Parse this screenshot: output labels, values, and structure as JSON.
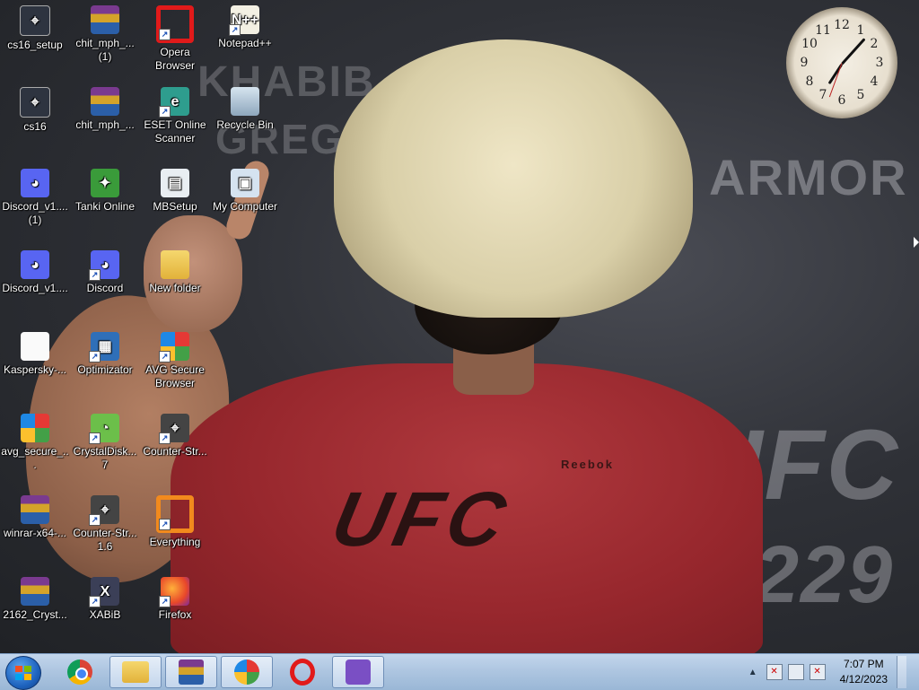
{
  "desktop": {
    "wallpaper_text": [
      "KHABIB",
      "GREGO",
      "ARMOR",
      "UFC",
      "229"
    ],
    "shirt_logo": "UFC",
    "shirt_brand": "Reebok",
    "icons": [
      {
        "label": "cs16_setup",
        "icon": "counter-strike-icon",
        "shortcut": false
      },
      {
        "label": "chit_mph_... (1)",
        "icon": "winrar-archive-icon",
        "shortcut": false
      },
      {
        "label": "Opera Browser",
        "icon": "opera-icon",
        "shortcut": true
      },
      {
        "label": "Notepad++",
        "icon": "notepad-plus-plus-icon",
        "shortcut": true
      },
      {
        "label": "cs16",
        "icon": "counter-strike-icon",
        "shortcut": false
      },
      {
        "label": "chit_mph_...",
        "icon": "winrar-archive-icon",
        "shortcut": false
      },
      {
        "label": "ESET Online Scanner",
        "icon": "eset-icon",
        "shortcut": true
      },
      {
        "label": "Recycle Bin",
        "icon": "recycle-bin-icon",
        "shortcut": false
      },
      {
        "label": "Discord_v1.... (1)",
        "icon": "discord-icon",
        "shortcut": false
      },
      {
        "label": "Tanki Online",
        "icon": "tanki-online-icon",
        "shortcut": false
      },
      {
        "label": "MBSetup",
        "icon": "installer-icon",
        "shortcut": false
      },
      {
        "label": "My Computer",
        "icon": "computer-icon",
        "shortcut": false
      },
      {
        "label": "Discord_v1....",
        "icon": "discord-icon",
        "shortcut": false
      },
      {
        "label": "Discord",
        "icon": "discord-icon",
        "shortcut": true
      },
      {
        "label": "New folder",
        "icon": "folder-icon",
        "shortcut": false
      },
      {
        "label": "Kaspersky-...",
        "icon": "file-icon",
        "shortcut": false
      },
      {
        "label": "Optimizator",
        "icon": "optimizator-icon",
        "shortcut": true
      },
      {
        "label": "AVG Secure Browser",
        "icon": "avg-browser-icon",
        "shortcut": true
      },
      {
        "label": "avg_secure_...",
        "icon": "avg-installer-icon",
        "shortcut": false
      },
      {
        "label": "CrystalDisk... 7",
        "icon": "crystaldisk-icon",
        "shortcut": true
      },
      {
        "label": "Counter-Str...",
        "icon": "counter-strike-icon",
        "shortcut": true
      },
      {
        "label": "winrar-x64-...",
        "icon": "winrar-installer-icon",
        "shortcut": false
      },
      {
        "label": "Counter-Str... 1.6",
        "icon": "counter-strike-icon",
        "shortcut": true
      },
      {
        "label": "Everything",
        "icon": "everything-search-icon",
        "shortcut": true
      },
      {
        "label": "2162_Cryst...",
        "icon": "winrar-archive-icon",
        "shortcut": false
      },
      {
        "label": "XABiB",
        "icon": "app-icon",
        "shortcut": true
      },
      {
        "label": "Firefox",
        "icon": "firefox-icon",
        "shortcut": true
      }
    ]
  },
  "clock_gadget": {
    "numbers": [
      "12",
      "1",
      "2",
      "3",
      "4",
      "5",
      "6",
      "7",
      "8",
      "9",
      "10",
      "11"
    ],
    "time": "7:07"
  },
  "taskbar": {
    "pinned": [
      {
        "name": "chrome",
        "icon": "chrome-icon",
        "active": false
      },
      {
        "name": "explorer",
        "icon": "folder-icon",
        "active": true
      },
      {
        "name": "winrar",
        "icon": "winrar-icon",
        "active": true
      },
      {
        "name": "avg-browser",
        "icon": "avg-browser-icon",
        "active": true
      },
      {
        "name": "opera",
        "icon": "opera-icon",
        "active": false
      },
      {
        "name": "visual-studio-installer",
        "icon": "visual-studio-icon",
        "active": true
      }
    ],
    "tray": {
      "time": "7:07 PM",
      "date": "4/12/2023",
      "icons": [
        "action-center-flag-icon",
        "network-icon",
        "volume-muted-icon"
      ]
    }
  }
}
